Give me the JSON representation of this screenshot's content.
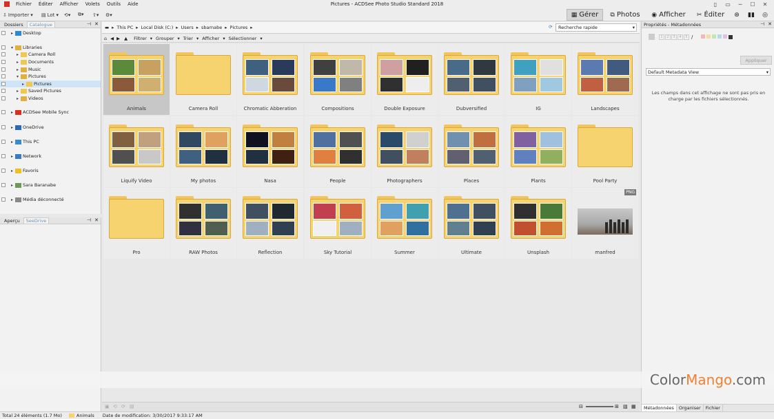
{
  "window": {
    "title": "Pictures - ACDSee Photo Studio Standard 2018"
  },
  "menu": [
    "Fichier",
    "Éditer",
    "Afficher",
    "Volets",
    "Outils",
    "Aide"
  ],
  "toolbar": {
    "import": "Importer",
    "batch": "Lot"
  },
  "modes": [
    {
      "label": "Gérer",
      "icon": "grid-icon"
    },
    {
      "label": "Photos",
      "icon": "photos-icon"
    },
    {
      "label": "Afficher",
      "icon": "eye-icon"
    },
    {
      "label": "Éditer",
      "icon": "edit-icon"
    }
  ],
  "folders_panel": {
    "tabs": [
      "Dossiers",
      "Catalogue"
    ],
    "items": [
      {
        "label": "Desktop",
        "indent": 0,
        "icon": "desktop-icon"
      },
      {
        "label": "Libraries",
        "indent": 0,
        "icon": "library-icon"
      },
      {
        "label": "Camera Roll",
        "indent": 1,
        "icon": "folder-icon"
      },
      {
        "label": "Documents",
        "indent": 1,
        "icon": "folder-icon"
      },
      {
        "label": "Music",
        "indent": 1,
        "icon": "music-icon"
      },
      {
        "label": "Pictures",
        "indent": 1,
        "icon": "pictures-icon"
      },
      {
        "label": "Pictures",
        "indent": 2,
        "icon": "folder-icon"
      },
      {
        "label": "Saved Pictures",
        "indent": 1,
        "icon": "folder-icon"
      },
      {
        "label": "Videos",
        "indent": 1,
        "icon": "video-icon"
      },
      {
        "label": "ACDSee Mobile Sync",
        "indent": 0,
        "icon": "sync-icon"
      },
      {
        "label": "OneDrive",
        "indent": 0,
        "icon": "cloud-icon"
      },
      {
        "label": "This PC",
        "indent": 0,
        "icon": "computer-icon"
      },
      {
        "label": "Network",
        "indent": 0,
        "icon": "network-icon"
      },
      {
        "label": "Favoris",
        "indent": 0,
        "icon": "star-icon"
      },
      {
        "label": "Sara Baranabe",
        "indent": 0,
        "icon": "user-icon"
      },
      {
        "label": "Média déconnecté",
        "indent": 0,
        "icon": "disconnected-icon"
      }
    ]
  },
  "preview_panel": {
    "tabs": [
      "Aperçu",
      "SeeDrive"
    ]
  },
  "breadcrumb": [
    "This PC",
    "Local Disk (C:)",
    "Users",
    "sbarnabe",
    "Pictures"
  ],
  "search": {
    "placeholder": "Recherche rapide"
  },
  "filterbar": [
    "Filtrer",
    "Grouper",
    "Trier",
    "Afficher",
    "Sélectionner"
  ],
  "grid": [
    {
      "label": "Animals",
      "empty": false,
      "colors": [
        "#5a8a3a",
        "#c8a060",
        "#8a5a3a",
        "#d0b070"
      ]
    },
    {
      "label": "Camera Roll",
      "empty": true
    },
    {
      "label": "Chromatic Abberation",
      "empty": false,
      "colors": [
        "#406080",
        "#2a3a5a",
        "#cfd8e0",
        "#6a4a3a"
      ]
    },
    {
      "label": "Compositions",
      "empty": false,
      "colors": [
        "#404040",
        "#c0b8a8",
        "#3a78c8",
        "#808080"
      ]
    },
    {
      "label": "Double Exposure",
      "empty": false,
      "colors": [
        "#d0a0a0",
        "#202020",
        "#303030",
        "#eeeeee"
      ]
    },
    {
      "label": "Dubversified",
      "empty": false,
      "colors": [
        "#4a6a8a",
        "#303840",
        "#506070",
        "#405060"
      ]
    },
    {
      "label": "IG",
      "empty": false,
      "colors": [
        "#40a0c0",
        "#e0e0e0",
        "#80a0c0",
        "#a0c8e0"
      ]
    },
    {
      "label": "Landscapes",
      "empty": false,
      "colors": [
        "#5a7ab0",
        "#405a80",
        "#c06040",
        "#a06a50"
      ]
    },
    {
      "label": "Liquify Video",
      "empty": false,
      "colors": [
        "#806040",
        "#c0a080",
        "#505050",
        "#c8c8c8"
      ]
    },
    {
      "label": "My photos",
      "empty": false,
      "colors": [
        "#304860",
        "#e0a060",
        "#406080",
        "#203040"
      ]
    },
    {
      "label": "Nasa",
      "empty": false,
      "colors": [
        "#101020",
        "#c08040",
        "#203040",
        "#402010"
      ]
    },
    {
      "label": "People",
      "empty": false,
      "colors": [
        "#5070a0",
        "#505050",
        "#e08040",
        "#303030"
      ]
    },
    {
      "label": "Photographers",
      "empty": false,
      "colors": [
        "#2a4a6a",
        "#d0d0d0",
        "#405060",
        "#c08060"
      ]
    },
    {
      "label": "Places",
      "empty": false,
      "colors": [
        "#7090b0",
        "#c07040",
        "#606070",
        "#506070"
      ]
    },
    {
      "label": "Plants",
      "empty": false,
      "colors": [
        "#8060a0",
        "#a0c0e0",
        "#6080c0",
        "#90b060"
      ]
    },
    {
      "label": "Pool Party",
      "empty": true
    },
    {
      "label": "Pro",
      "empty": true
    },
    {
      "label": "RAW Photos",
      "empty": false,
      "colors": [
        "#303030",
        "#406070",
        "#303040",
        "#506050"
      ]
    },
    {
      "label": "Reflection",
      "empty": false,
      "colors": [
        "#405060",
        "#202830",
        "#a0b0c0",
        "#304050"
      ]
    },
    {
      "label": "Sky Tutorial",
      "empty": false,
      "colors": [
        "#c04050",
        "#d06040",
        "#f0f0f0",
        "#a0b0c0"
      ]
    },
    {
      "label": "Summer",
      "empty": false,
      "colors": [
        "#60a0d0",
        "#40a0b0",
        "#e0a060",
        "#3070a0"
      ]
    },
    {
      "label": "Ultimate",
      "empty": false,
      "colors": [
        "#507090",
        "#405060",
        "#608090",
        "#304050"
      ]
    },
    {
      "label": "Unsplash",
      "empty": false,
      "colors": [
        "#303030",
        "#4a7a3a",
        "#c05030",
        "#d07030"
      ]
    },
    {
      "label": "manfred",
      "empty": false,
      "image": true,
      "badge": "PNG"
    }
  ],
  "right_panel": {
    "title": "Propriétés - Métadonnées",
    "stars": [
      "1",
      "2",
      "3",
      "4",
      "5"
    ],
    "color_labels": [
      "#f2b8b8",
      "#f2e0a0",
      "#c0e8b0",
      "#b8d8f0",
      "#e0c0e8"
    ],
    "apply_button": "Appliquer",
    "view_select": "Default Metadata View",
    "message": "Les champs dans cet affichage ne sont pas pris en charge par les fichiers sélectionnés.",
    "tabs": [
      "Métadonnées",
      "Organiser",
      "Fichier"
    ]
  },
  "status": {
    "total": "Total 24 éléments  (1.7 Mo)",
    "selected": "Animals",
    "modified": "Date de modification: 3/30/2017 9:33:17 AM"
  },
  "watermark": {
    "part1": "Color",
    "part2": "Mango",
    "part3": ".com"
  }
}
